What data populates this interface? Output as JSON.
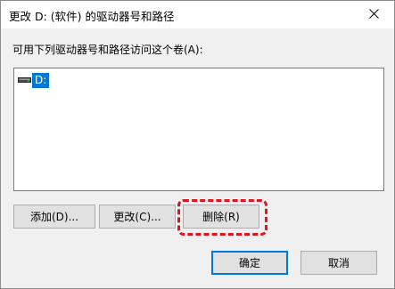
{
  "window": {
    "title": "更改 D: (软件) 的驱动器号和路径",
    "close_icon": "close-icon"
  },
  "instruction": "可用下列驱动器号和路径访问这个卷(A):",
  "list": {
    "items": [
      {
        "label": "D:",
        "icon": "drive-icon",
        "selected": true
      }
    ]
  },
  "buttons": {
    "add": "添加(D)...",
    "change": "更改(C)...",
    "remove": "删除(R)",
    "ok": "确定",
    "cancel": "取消"
  },
  "colors": {
    "selection": "#0078d7",
    "highlight": "#e0141e",
    "window_bg": "#f0f0f0"
  }
}
